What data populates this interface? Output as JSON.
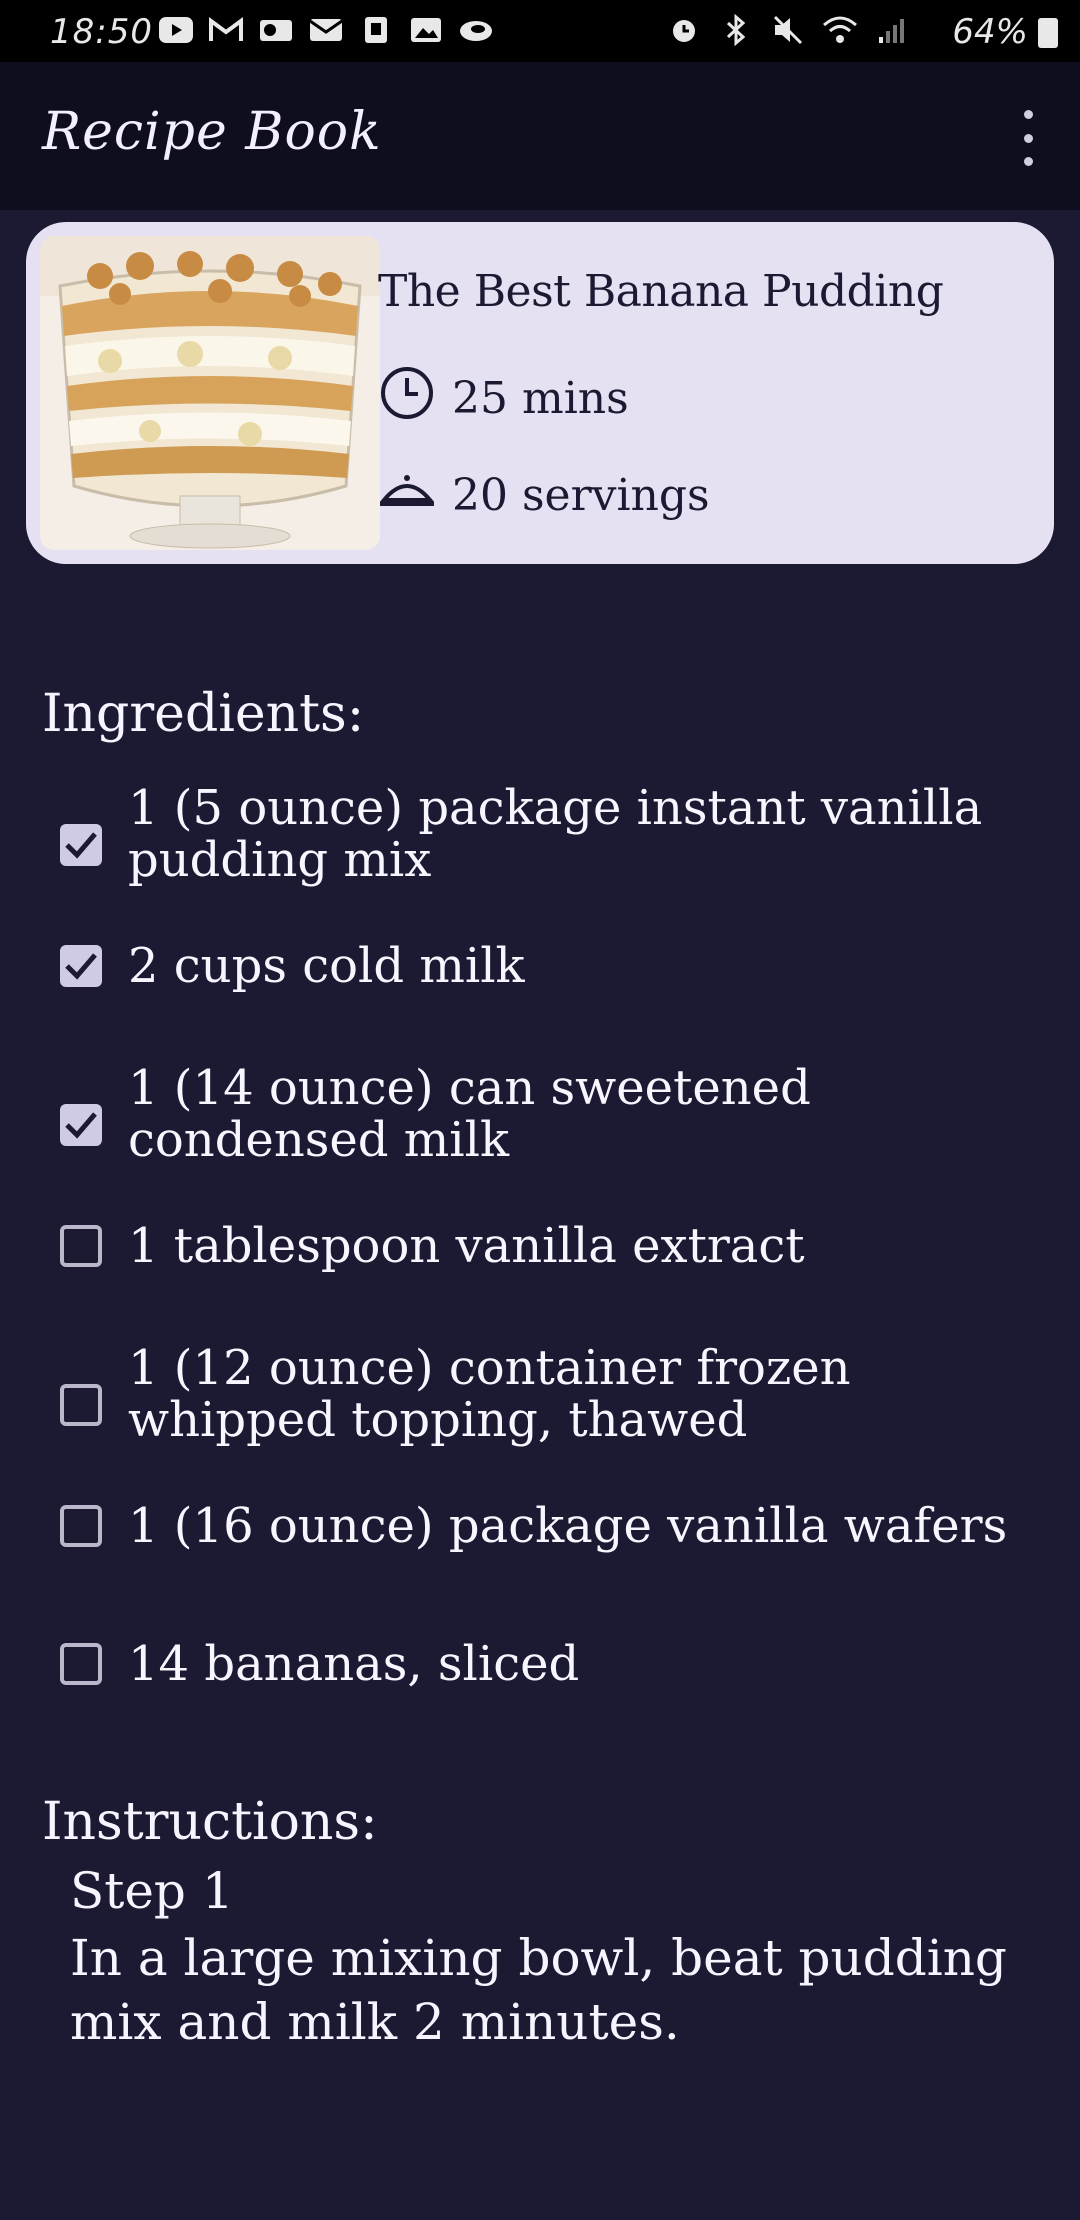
{
  "status_bar": {
    "time": "18:50",
    "battery": "64%",
    "left_icons": [
      "youtube-icon",
      "gmail-icon",
      "outlook-icon",
      "email-icon",
      "app-icon",
      "gallery-icon",
      "cloud-icon"
    ],
    "right_icons": [
      "alarm-icon",
      "bluetooth-icon",
      "mute-icon",
      "wifi-icon",
      "signal-icon"
    ]
  },
  "app_bar": {
    "title": "Recipe Book",
    "menu_icon": "more-vert-icon"
  },
  "recipe": {
    "name": "The Best Banana Pudding",
    "time": "25 mins",
    "servings": "20 servings"
  },
  "ingredients": {
    "title": "Ingredients:",
    "items": [
      {
        "text": "1 (5 ounce) package instant vanilla pudding mix",
        "checked": true
      },
      {
        "text": "2 cups cold milk",
        "checked": true
      },
      {
        "text": "1 (14 ounce) can sweetened condensed milk",
        "checked": true
      },
      {
        "text": "1 tablespoon vanilla extract",
        "checked": false
      },
      {
        "text": "1 (12 ounce) container frozen whipped topping, thawed",
        "checked": false
      },
      {
        "text": "1 (16 ounce) package vanilla wafers",
        "checked": false
      },
      {
        "text": "14 bananas, sliced",
        "checked": false
      }
    ]
  },
  "instructions": {
    "title": "Instructions:",
    "steps": [
      {
        "title": "Step 1",
        "text": "In a large mixing bowl, beat pudding mix and milk 2 minutes."
      }
    ]
  },
  "colors": {
    "background": "#1c1a33",
    "app_bar": "#0f0e1f",
    "card": "#e6e1f2",
    "checkbox_checked": "#cfcbe6"
  }
}
